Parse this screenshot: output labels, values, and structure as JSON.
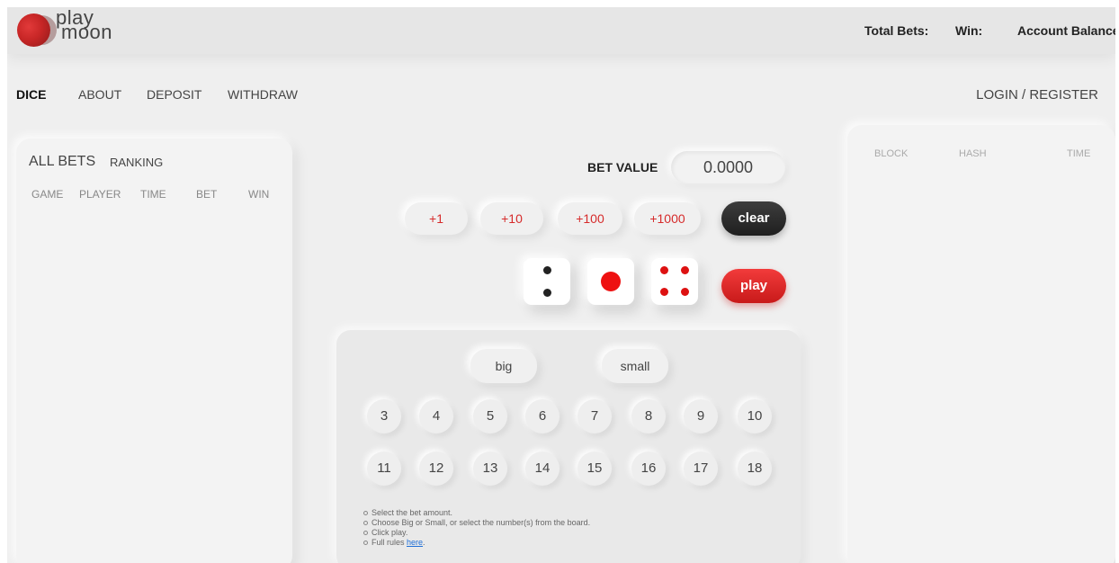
{
  "brand": {
    "line1": "play",
    "line2": "moon",
    "colors": {
      "accent": "#d62b2b",
      "dark": "#2a2a2a",
      "background": "#efefef"
    }
  },
  "header": {
    "total_bets": "Total Bets:",
    "win": "Win:",
    "balance": "Account Balance"
  },
  "nav": {
    "items": [
      "DICE",
      "ABOUT",
      "DEPOSIT",
      "WITHDRAW"
    ],
    "active": "DICE",
    "login": "LOGIN / REGISTER"
  },
  "bets_panel": {
    "title": "ALL BETS",
    "subtitle": "RANKING",
    "columns": [
      "GAME",
      "PLAYER",
      "TIME",
      "BET",
      "WIN"
    ]
  },
  "blocks_panel": {
    "columns": [
      "BLOCK",
      "HASH",
      "TIME"
    ]
  },
  "bet": {
    "label": "BET VALUE",
    "value": "0.0000",
    "increments": [
      "+1",
      "+10",
      "+100",
      "+1000"
    ],
    "clear": "clear",
    "play": "play"
  },
  "dice": [
    {
      "face": 2,
      "color": "#222222"
    },
    {
      "face": 1,
      "color": "#ee1111"
    },
    {
      "face": 4,
      "color": "#dd1111"
    }
  ],
  "board": {
    "big": "big",
    "small": "small",
    "row1": [
      "3",
      "4",
      "5",
      "6",
      "7",
      "8",
      "9",
      "10"
    ],
    "row2": [
      "11",
      "12",
      "13",
      "14",
      "15",
      "16",
      "17",
      "18"
    ],
    "rules": [
      "Select the bet amount.",
      "Choose Big or Small, or select the number(s) from the board.",
      "Click play."
    ],
    "rules_last_prefix": "Full rules ",
    "rules_link": "here",
    "rules_last_suffix": "."
  }
}
